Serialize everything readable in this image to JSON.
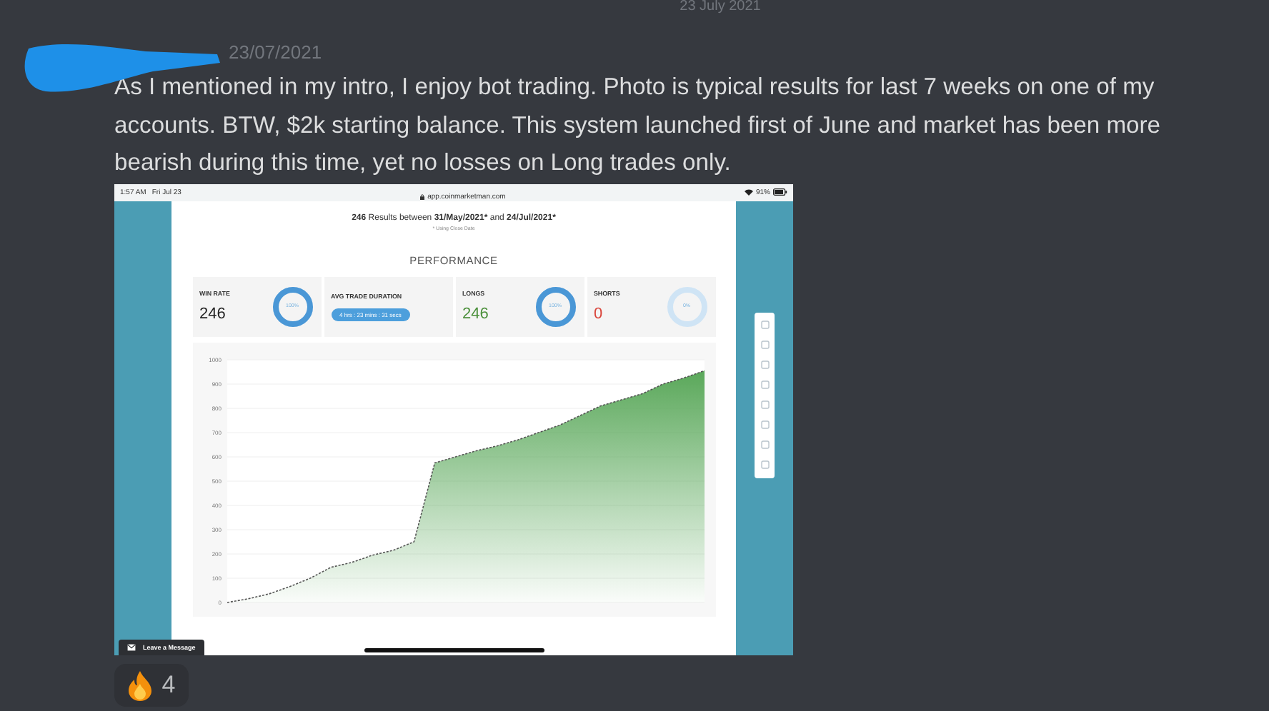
{
  "date_divider": "23 July 2021",
  "message": {
    "timestamp": "23/07/2021",
    "text": "As I mentioned in my intro, I enjoy bot trading. Photo is typical results for last 7 weeks on one of my accounts. BTW, $2k starting balance. This system launched first of June and market has been more bearish during this time, yet no losses on Long trades only.",
    "attachment": {
      "status_bar": {
        "time": "1:57 AM",
        "day": "Fri Jul 23",
        "url": "app.coinmarketman.com",
        "battery": "91%"
      },
      "results_header": {
        "count": "246",
        "before": "Results between",
        "start": "31/May/2021*",
        "middle": "and",
        "end": "24/Jul/2021*"
      },
      "note": "* Using Close Date",
      "section_title": "PERFORMANCE",
      "stats": [
        {
          "kind": "ring",
          "label": "WIN RATE",
          "value": "246",
          "color": "#222222",
          "ring_label": "100%",
          "level": 1
        },
        {
          "kind": "pill",
          "label": "AVG TRADE DURATION",
          "pill": "4 hrs : 23 mins : 31 secs"
        },
        {
          "kind": "ring",
          "label": "LONGS",
          "value": "246",
          "color": "#4a8f3a",
          "ring_label": "100%",
          "level": 1
        },
        {
          "kind": "ring",
          "label": "SHORTS",
          "value": "0",
          "color": "#d9443a",
          "ring_label": "0%",
          "level": 0
        }
      ],
      "chart_data": {
        "type": "area",
        "grid": true,
        "series": [
          {
            "color": "#5aa85a",
            "values": [
              0,
              15,
              35,
              65,
              100,
              145,
              165,
              195,
              215,
              250,
              575,
              600,
              625,
              645,
              670,
              700,
              730,
              770,
              810,
              835,
              860,
              900,
              925,
              955
            ]
          }
        ],
        "ylim": [
          0,
          1000
        ],
        "yticks": [
          0,
          100,
          200,
          300,
          400,
          500,
          600,
          700,
          800,
          900,
          1000
        ]
      },
      "leave_message_button": "Leave a Message"
    },
    "reactions": [
      {
        "count": "4"
      }
    ]
  }
}
